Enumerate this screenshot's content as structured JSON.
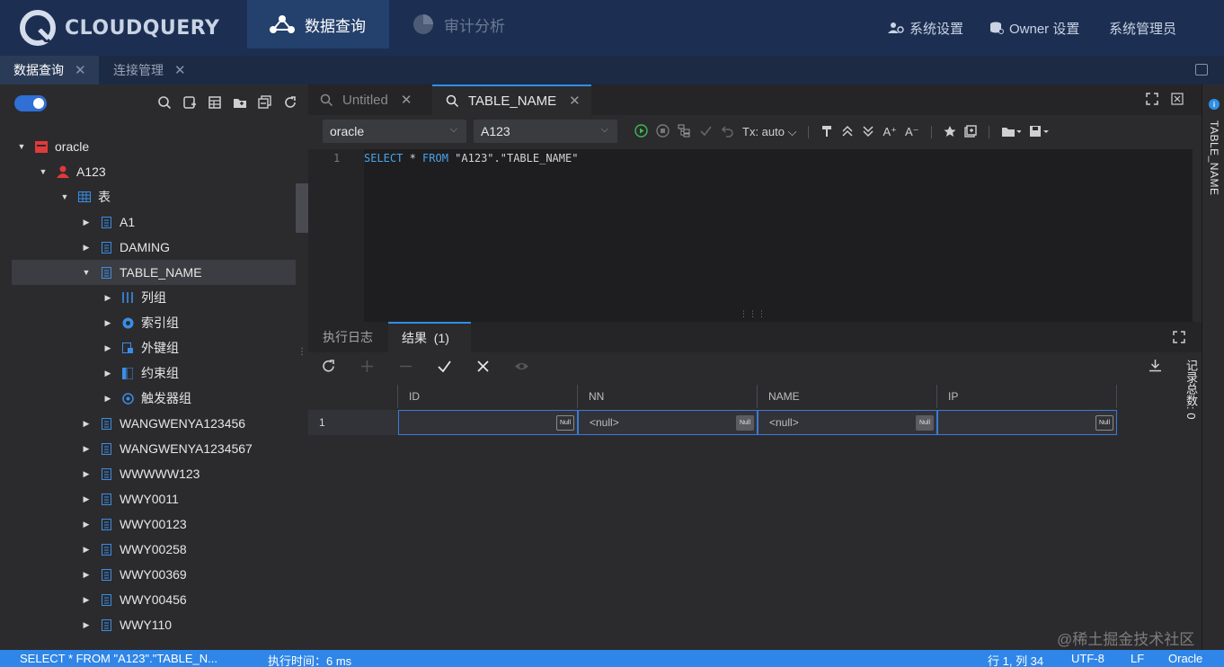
{
  "app": {
    "logo_text": "CLOUDQUERY",
    "nav_tabs": [
      {
        "label": "数据查询",
        "active": true
      },
      {
        "label": "审计分析",
        "active": false
      }
    ],
    "nav_right": [
      "系统设置",
      "Owner 设置",
      "系统管理员"
    ]
  },
  "page_tabs": [
    {
      "label": "数据查询",
      "active": true
    },
    {
      "label": "连接管理",
      "active": false
    }
  ],
  "sidebar": {
    "tree": [
      {
        "label": "oracle",
        "icon": "database-icon",
        "expanded": true
      },
      {
        "label": "A123",
        "icon": "schema-user-icon",
        "expanded": true
      },
      {
        "label": "表",
        "icon": "table-group-icon",
        "expanded": true
      },
      {
        "label": "A1",
        "icon": "table-icon"
      },
      {
        "label": "DAMING",
        "icon": "table-icon"
      },
      {
        "label": "TABLE_NAME",
        "icon": "table-icon",
        "expanded": true,
        "selected": true
      },
      {
        "label": "列组",
        "icon": "columns-icon"
      },
      {
        "label": "索引组",
        "icon": "index-icon"
      },
      {
        "label": "外键组",
        "icon": "foreign-key-icon"
      },
      {
        "label": "约束组",
        "icon": "constraint-icon"
      },
      {
        "label": "触发器组",
        "icon": "trigger-icon"
      },
      {
        "label": "WANGWENYA123456",
        "icon": "table-icon"
      },
      {
        "label": "WANGWENYA1234567",
        "icon": "table-icon"
      },
      {
        "label": "WWWWW123",
        "icon": "table-icon"
      },
      {
        "label": "WWY0011",
        "icon": "table-icon"
      },
      {
        "label": "WWY00123",
        "icon": "table-icon"
      },
      {
        "label": "WWY00258",
        "icon": "table-icon"
      },
      {
        "label": "WWY00369",
        "icon": "table-icon"
      },
      {
        "label": "WWY00456",
        "icon": "table-icon"
      },
      {
        "label": "WWY110",
        "icon": "table-icon"
      }
    ]
  },
  "editor": {
    "tabs": [
      {
        "label": "Untitled",
        "active": false
      },
      {
        "label": "TABLE_NAME",
        "active": true
      }
    ],
    "connection": "oracle",
    "schema": "A123",
    "tx_mode": "Tx: auto",
    "line_number": "1",
    "sql": {
      "select": "SELECT",
      "star": " * ",
      "from": "FROM",
      "target": " \"A123\".\"TABLE_NAME\""
    }
  },
  "results": {
    "tabs": [
      {
        "label": "执行日志",
        "active": false
      },
      {
        "label": "结果  (1)",
        "active": true
      }
    ],
    "columns": [
      "ID",
      "NN",
      "NAME",
      "IP"
    ],
    "rows": [
      {
        "row_no": "1",
        "cells": [
          "",
          "<null>",
          "<null>",
          ""
        ]
      }
    ],
    "null_badge": "Null",
    "record_count_label": "记录总数: 0"
  },
  "right_rail": {
    "label": "TABLE_NAME"
  },
  "statusbar": {
    "query": "SELECT * FROM \"A123\".\"TABLE_N...",
    "exec_time": "执行时间：6 ms",
    "position": "行 1, 列 34",
    "encoding": "UTF-8",
    "line_ending": "LF",
    "dialect": "Oracle"
  },
  "watermark": "@稀土掘金技术社区",
  "colors": {
    "nav_bg": "#1c2f52",
    "accent": "#2f86e8",
    "db_red": "#e03a3a",
    "table_blue": "#3a8ee6"
  }
}
